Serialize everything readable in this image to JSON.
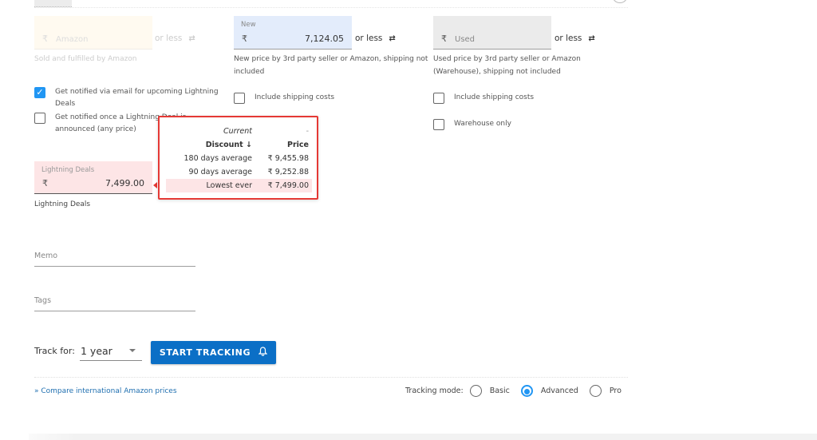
{
  "price_fields": {
    "amazon": {
      "currency": "₹",
      "placeholder": "Amazon",
      "suffix": "or less",
      "helper": "Sold and fulfilled by Amazon"
    },
    "new": {
      "label": "New",
      "currency": "₹",
      "value": "7,124.05",
      "suffix": "or less",
      "helper": "New price by 3rd party seller or Amazon, shipping not included"
    },
    "used": {
      "currency": "₹",
      "placeholder": "Used",
      "suffix": "or less",
      "helper": "Used price by 3rd party seller or Amazon (Warehouse), shipping not included"
    }
  },
  "swap_icon": "⇄",
  "lightning": {
    "notify_email": {
      "label": "Get notified via email for upcoming Lightning Deals",
      "checked": true
    },
    "notify_any": {
      "label": "Get notified once a Lightning Deal is announced (any price)",
      "checked": false
    },
    "field": {
      "label": "Lightning Deals",
      "currency": "₹",
      "value": "7,499.00",
      "helper": "Lightning Deals"
    }
  },
  "new_options": {
    "include_shipping": {
      "label": "Include shipping costs",
      "checked": false
    }
  },
  "used_options": {
    "include_shipping": {
      "label": "Include shipping costs",
      "checked": false
    },
    "warehouse_only": {
      "label": "Warehouse only",
      "checked": false
    }
  },
  "popup": {
    "rows": [
      {
        "label": "Current",
        "value": "-"
      },
      {
        "label": "Discount ↓",
        "value": "Price"
      },
      {
        "label": "180 days average",
        "value": "₹ 9,455.98"
      },
      {
        "label": "90 days average",
        "value": "₹ 9,252.88"
      },
      {
        "label": "Lowest ever",
        "value": "₹ 7,499.00"
      }
    ],
    "border_color": "#e53935"
  },
  "memo": {
    "placeholder": "Memo"
  },
  "tags": {
    "placeholder": "Tags"
  },
  "track": {
    "label": "Track for:",
    "selected": "1 year"
  },
  "start_button": {
    "label": "START TRACKING",
    "icon": "bell-icon",
    "color": "#0b6fc6"
  },
  "compare_link": "» Compare international Amazon prices",
  "tracking_mode": {
    "label": "Tracking mode:",
    "options": [
      "Basic",
      "Advanced",
      "Pro"
    ],
    "selected": "Advanced",
    "accent": "#2196f3"
  }
}
